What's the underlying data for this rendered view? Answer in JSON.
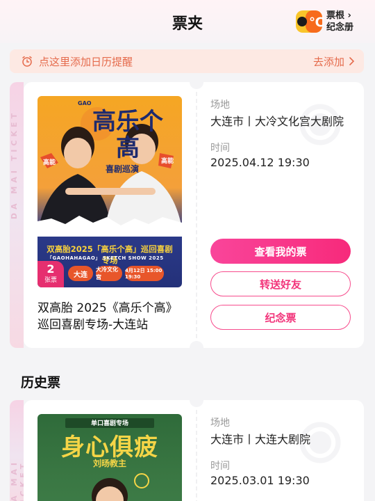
{
  "header": {
    "title": "票夹",
    "album_entry": {
      "line1": "票根 ›",
      "line2": "纪念册",
      "logo_text": "3℃"
    }
  },
  "reminder": {
    "label": "点这里添加日历提醒",
    "action": "去添加"
  },
  "ticket_side_text": "DA MAI TICKET",
  "current_ticket": {
    "poster": {
      "top_tag": "GAO",
      "title": "高乐个高",
      "subtitle": "喜剧巡演",
      "side_tag": "高能",
      "tour_line": "双高胎2025「高乐个高」巡回喜剧专场",
      "show_line": "「GAOHAHAGAO」 SKETCH SHOW 2025",
      "city": "大连",
      "venue": "大冷文化宫",
      "date_time": "4月12日 15:00 19:30"
    },
    "count": "2",
    "count_unit": "张票",
    "event_title": "双高胎 2025《高乐个高》巡回喜剧专场-大连站",
    "venue_label": "场地",
    "venue_value": "大连市丨大冷文化宫大剧院",
    "time_label": "时间",
    "time_value": "2025.04.12 19:30",
    "buttons": {
      "view": "查看我的票",
      "transfer": "转送好友",
      "souvenir": "纪念票"
    }
  },
  "history_section": {
    "title": "历史票",
    "tickets": [
      {
        "poster": {
          "tag": "单口喜剧专场",
          "title": "身心俱疲",
          "subtitle": "刘旸教主"
        },
        "venue_label": "场地",
        "venue_value": "大连市丨大连大剧院",
        "time_label": "时间",
        "time_value": "2025.03.01 19:30"
      }
    ]
  },
  "colors": {
    "accent_pink": "#f72a7b",
    "reminder_text": "#e56b4c",
    "reminder_bg": "#fde9e3"
  }
}
